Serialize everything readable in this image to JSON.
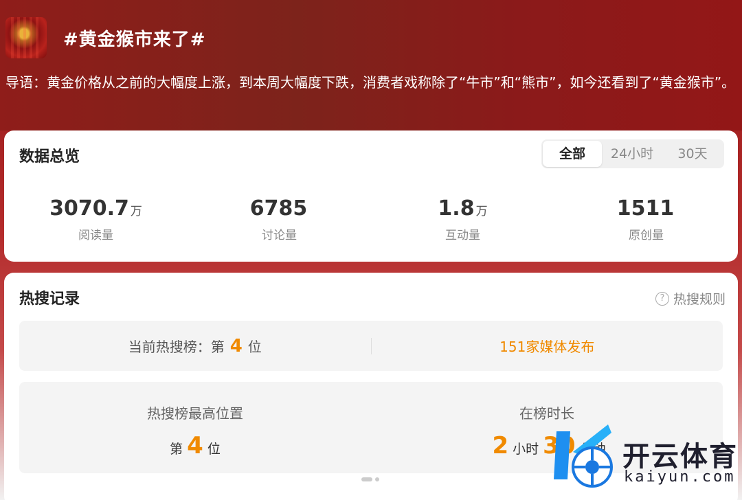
{
  "header": {
    "title": "#黄金猴市来了#",
    "thumbnail_icon": "gold-monkey-thumbnail"
  },
  "intro": "导语：黄金价格从之前的大幅度上涨，到本周大幅度下跌，消费者戏称除了“牛市”和“熊市”，如今还看到了“黄金猴市”。",
  "overview": {
    "title": "数据总览",
    "tabs": [
      "全部",
      "24小时",
      "30天"
    ],
    "active_tab": "全部",
    "stats": [
      {
        "value": "3070.7",
        "unit": "万",
        "label": "阅读量"
      },
      {
        "value": "6785",
        "unit": "",
        "label": "讨论量"
      },
      {
        "value": "1.8",
        "unit": "万",
        "label": "互动量"
      },
      {
        "value": "1511",
        "unit": "",
        "label": "原创量"
      }
    ]
  },
  "hot": {
    "title": "热搜记录",
    "rules_label": "热搜规则",
    "rules_icon": "question-circle-icon",
    "current_prefix": "当前热搜榜：第",
    "current_rank": "4",
    "current_suffix": "位",
    "media": "151家媒体发布",
    "highest_title": "热搜榜最高位置",
    "highest_prefix": "第",
    "highest_rank": "4",
    "highest_suffix": "位",
    "duration_title": "在榜时长",
    "duration_hours": "2",
    "hours_unit": "小时",
    "duration_minutes": "30",
    "minutes_unit": "分钟"
  },
  "watermark": {
    "text": "开云体育",
    "sub": "kaiyun.com"
  },
  "colors": {
    "accent": "#f08a00",
    "header_red": "#8e1a1a"
  }
}
